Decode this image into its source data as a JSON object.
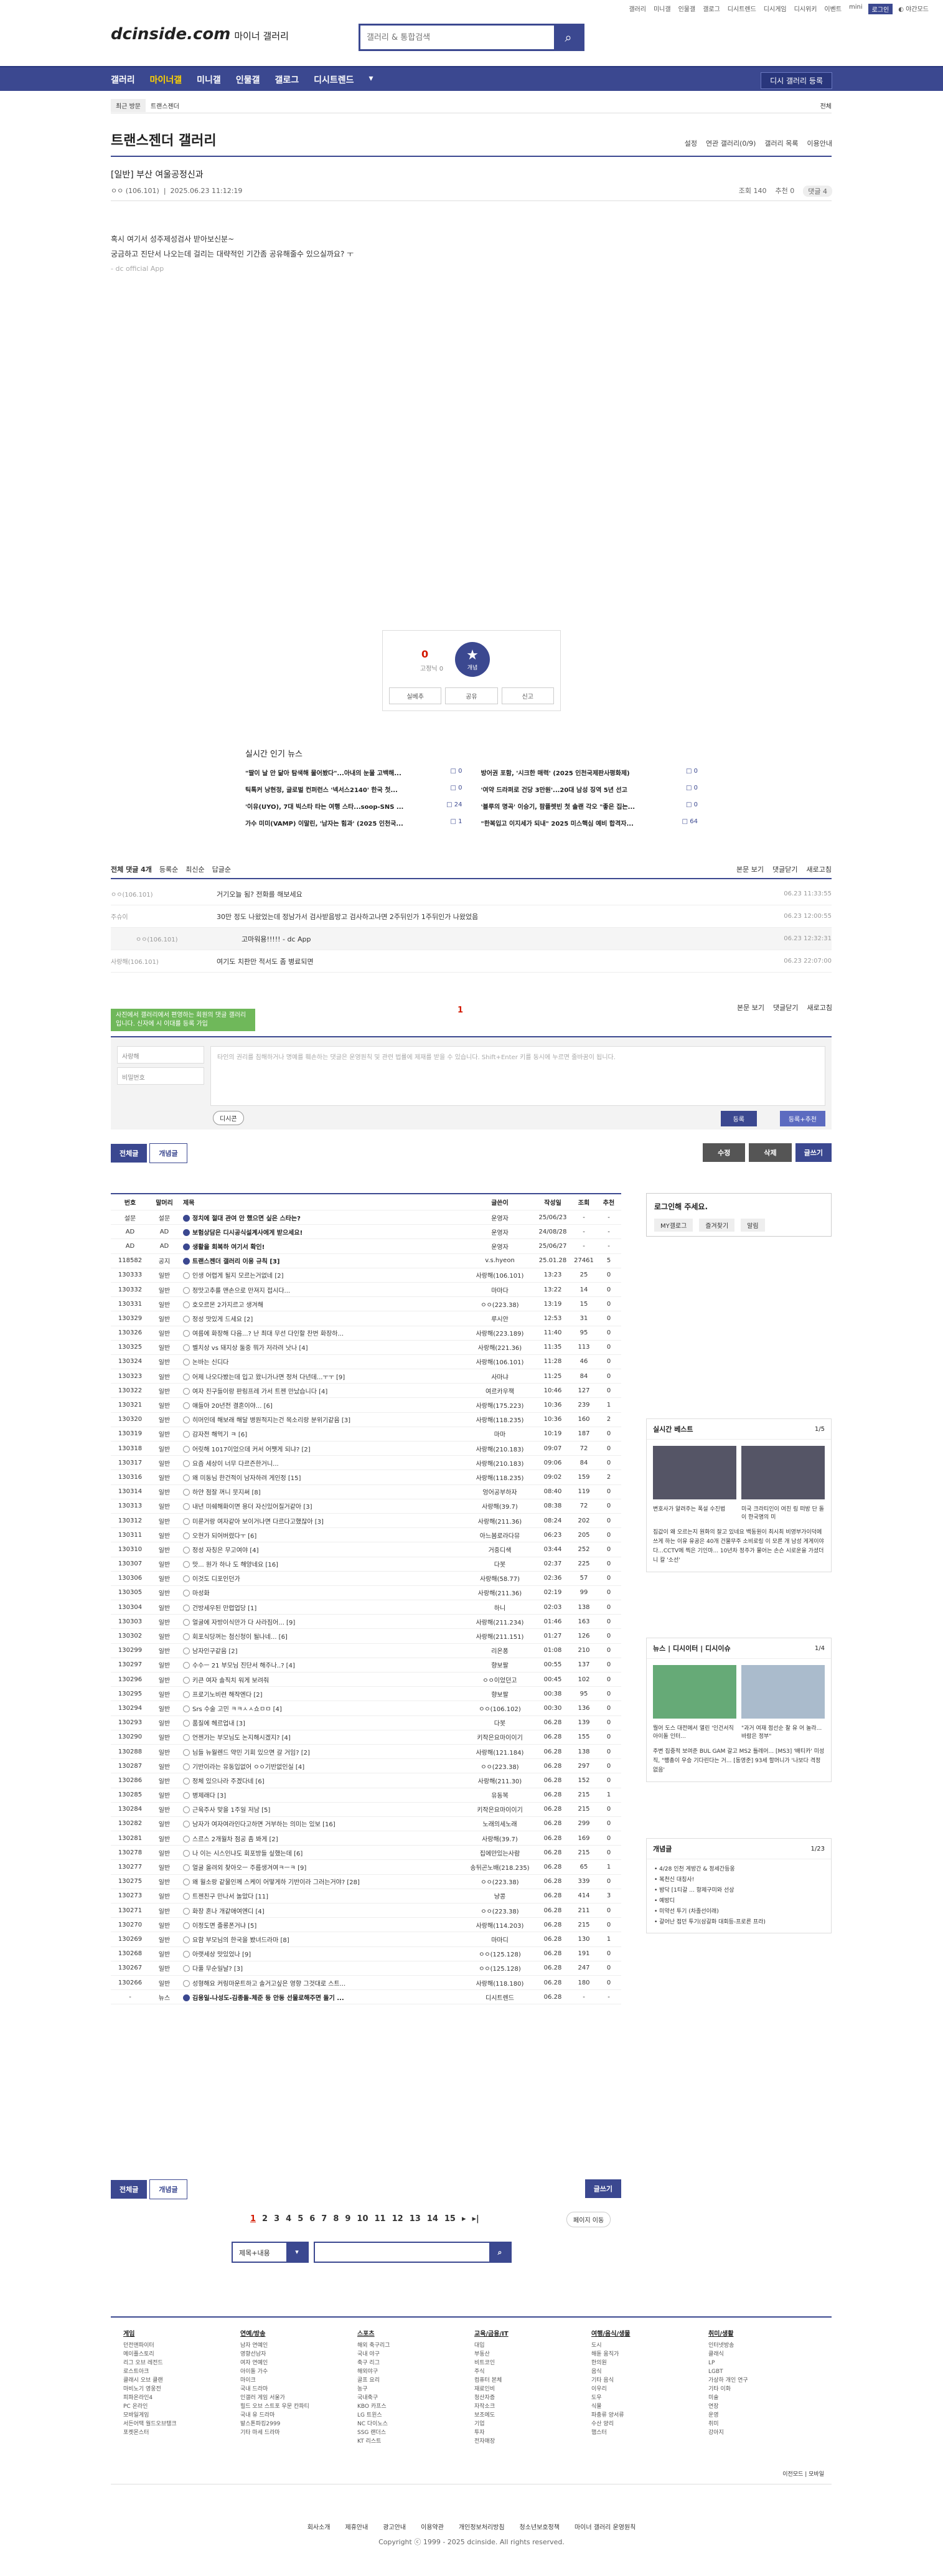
{
  "top": {
    "links": [
      "갤러리",
      "미니갤",
      "인물갤",
      "갤로그",
      "디시트렌드",
      "디시게임",
      "디시위키",
      "이벤트",
      "mini"
    ],
    "login": "로그인",
    "dark": "야간모드"
  },
  "logo": {
    "brand": "dcinside.com",
    "sub": "마이너 갤러리"
  },
  "search": {
    "placeholder": "갤러리 & 통합검색"
  },
  "gnb": {
    "items": [
      "갤러리",
      "마이너갤",
      "미니갤",
      "인물갤",
      "갤로그",
      "디시트렌드"
    ],
    "apply": "디시 갤러리 등록"
  },
  "crumb": {
    "recent": "최근 방문",
    "item": "트랜스젠더",
    "all": "전체"
  },
  "gallery": {
    "title": "트랜스젠더 갤러리",
    "tools": [
      "설정",
      "연관 갤러리(0/9)",
      "갤러리 목록",
      "이용안내"
    ]
  },
  "post": {
    "title": "[일반] 부산 여울공정신과",
    "author": "ㅇㅇ",
    "ip": "(106.101)",
    "date": "2025.06.23 11:12:19",
    "views": "조회 140",
    "recommend": "추천 0",
    "comments": "댓글 4",
    "body": [
      "혹시 여기서 성주제성검사 받아보신분~",
      "궁금하고 진단서 나오는데 걸리는 대략적인 기간좀 공유해줄수 있으실까요? ㅜ"
    ],
    "sign": "- dc official App"
  },
  "vote": {
    "count": "0",
    "sub": "고정닉 0",
    "label": "개념",
    "buttons": [
      "실베추",
      "공유",
      "신고"
    ]
  },
  "hot": {
    "title": "실시간 인기 뉴스",
    "items": [
      {
        "t": "\"딸이 날 안 닮아 탐색해 물어봤다\"...아내의 눈물 고백해...",
        "c": "0"
      },
      {
        "t": "방어권 포함, '시크한 매력' (2025 인천국제판사평화제)",
        "c": "0"
      },
      {
        "t": "틱톡커 낭현정, 글로벌 컨퍼런스 '넥서스2140' 한국 첫...",
        "c": "0"
      },
      {
        "t": "'여약 드라퍼로 건당 3만원'...20대 남성 징역 5년 선고",
        "c": "0"
      },
      {
        "t": "'이유(UYO), 7대 빅스타 타는 여행 스타...soop-SNS ...",
        "c": "24"
      },
      {
        "t": "'블루의 명곡' 이승기, 팜플렛빈 첫 솔랜 각오 \"좋은 집는...",
        "c": "0"
      },
      {
        "t": "가수 미미(VAMP) 이말린, '남자는 힘과' (2025 인천국...",
        "c": "1"
      },
      {
        "t": "\"한복입고 이지세가 되내\" 2025 미스핵심 예비 합격자...",
        "c": "64"
      }
    ]
  },
  "cbar": {
    "total": "전체 댓글 4개",
    "opts": [
      "등록순",
      "최신순",
      "답글순"
    ],
    "right": [
      "본문 보기",
      "댓글닫기",
      "새로고침"
    ]
  },
  "comments": [
    {
      "w": "ㅇㅇ(106.101)",
      "t": "거기오늘 됨? 전화를 해보세요",
      "d": "06.23 11:33:55"
    },
    {
      "w": "주슈이",
      "t": "30만 정도 나왔었는데 정남가서 검사받음방고 검사하고나면 2주뒤인가 1주뒤인가 나왔었음",
      "d": "06.23 12:00:55"
    },
    {
      "w": "ㅇㅇ(106.101)",
      "t": "고마워용!!!!! - dc App",
      "d": "06.23 12:32:31",
      "reply": true
    },
    {
      "w": "사랑해(106.101)",
      "t": "여기도 치판만 적서도 좀 병료되면",
      "d": "06.23 22:07:00"
    }
  ],
  "notice": "사진에서 갤러리에서 편영하는 회원의 댓글 갤러리입니다. 신자에 시 이대를 등록 가입",
  "page_one": "1",
  "cform": {
    "id": "사랑해",
    "pw": "비밀번호",
    "ta": "타인의 권리를 침해하거나 명예를 훼손하는 댓글은 운영원칙 및 관련 법률에 제재를 받을 수 있습니다. Shift+Enter 키를 동시에 누르면 줄바꿈이 됩니다.",
    "dccon": "디시콘",
    "reg": "등록",
    "reg2": "등록+추천"
  },
  "actions": {
    "all": "전체글",
    "best": "개념글",
    "edit": "수정",
    "del": "삭제",
    "write": "글쓰기"
  },
  "list": {
    "head": [
      "번호",
      "말머리",
      "제목",
      "글쓴이",
      "작성일",
      "조회",
      "추천"
    ],
    "rows": [
      [
        "설문",
        "설문",
        "정치에 절대 관여 안 했으면 싶은 스타는?",
        "운영자",
        "25/06/23",
        "-",
        "-",
        "n"
      ],
      [
        "AD",
        "AD",
        "보험상담은 디시공식설계사에게 받으세요!",
        "운영자",
        "24/08/28",
        "-",
        "-",
        "n"
      ],
      [
        "AD",
        "AD",
        "생활을 회복하 여기서 확인!",
        "운영자",
        "25/06/27",
        "-",
        "-",
        "n"
      ],
      [
        "118582",
        "공지",
        "트랜스젠더 갤러리 이용 규칙 [3]",
        "v.s.hyeon",
        "25.01.28",
        "27461",
        "5",
        "n"
      ],
      [
        "130333",
        "일반",
        "인생 어렵게 될지 모르는거없네 [2]",
        "사랑해(106.101)",
        "13:23",
        "25",
        "0"
      ],
      [
        "130332",
        "일반",
        "정맛고추를 맨손으로 만져지 접시다...",
        "마마다",
        "13:22",
        "14",
        "0"
      ],
      [
        "130331",
        "일반",
        "호오르몬 2가지르고 생겨해",
        "ㅇㅇ(223.38)",
        "13:19",
        "15",
        "0"
      ],
      [
        "130329",
        "일반",
        "정성 맛있게 드세요 [2]",
        "루시안",
        "12:53",
        "31",
        "0"
      ],
      [
        "130326",
        "일반",
        "여름에 화장해 다음...? 난 최대 무선 다인할 찬번 화장하...",
        "사랑해(223.189)",
        "11:40",
        "95",
        "0"
      ],
      [
        "130325",
        "일반",
        "벨치상 vs 돼지상 둘중 뭐가 저라려 낫나 [4]",
        "사랑해(221.36)",
        "11:35",
        "113",
        "0"
      ],
      [
        "130324",
        "일반",
        "논바는 신디다",
        "사랑해(106.101)",
        "11:28",
        "46",
        "0"
      ],
      [
        "130323",
        "일반",
        "어제 나오다봤는데 입고 왔니가나면 정처 다년데...ㅜㅜ [9]",
        "사마냐",
        "11:25",
        "84",
        "0"
      ],
      [
        "130322",
        "일반",
        "여자 친구들이랑 판링프레 가서 트젠 만났습니다 [4]",
        "여르카우잭",
        "10:46",
        "127",
        "0"
      ],
      [
        "130321",
        "일반",
        "얘들아 20년전 결혼이야... [6]",
        "사랑해(175.223)",
        "10:36",
        "239",
        "1"
      ],
      [
        "130320",
        "일반",
        "히머인데 해보래 해달 병원적지는건 목소리랑 분위기같음 [3]",
        "사랑해(118.235)",
        "10:36",
        "160",
        "2"
      ],
      [
        "130319",
        "일반",
        "감자전 해먹기 ㅋ [6]",
        "마마",
        "10:19",
        "187",
        "0"
      ],
      [
        "130318",
        "일반",
        "어릿해 1017이었으데 커서 어쨋게 되냐? [2]",
        "사랑해(210.183)",
        "09:07",
        "72",
        "0"
      ],
      [
        "130317",
        "일반",
        "요즘 세상이 너무 다르즌한거니...",
        "사랑해(210.183)",
        "09:06",
        "84",
        "0"
      ],
      [
        "130316",
        "일반",
        "왜 미동님 한건적이 남자하려 게인정 [15]",
        "사랑해(118.235)",
        "09:02",
        "159",
        "2"
      ],
      [
        "130314",
        "일반",
        "하얀 점잘 꺼니 뭇지써 [8]",
        "엉어공부하자",
        "08:40",
        "119",
        "0"
      ],
      [
        "130313",
        "일반",
        "내년 미쉐해화이면 용더 자신있어질거같아 [3]",
        "사랑해(39.7)",
        "08:38",
        "72",
        "0"
      ],
      [
        "130312",
        "일반",
        "미룬거랑 여자같아 보이거나면 다르다고했잖아 [3]",
        "사랑해(211.36)",
        "08:24",
        "202",
        "0"
      ],
      [
        "130311",
        "일반",
        "오현가 되어버렸다ㅜ [6]",
        "아느봄로라다뮤",
        "06:23",
        "205",
        "0"
      ],
      [
        "130310",
        "일반",
        "정성 자칭은 무고여야 [4]",
        "거중디색",
        "03:44",
        "252",
        "0"
      ],
      [
        "130307",
        "일반",
        "맛... 원가 하나 도 해양네요 [16]",
        "다봇",
        "02:37",
        "225",
        "0"
      ],
      [
        "130306",
        "일반",
        "이것도 디포인던가",
        "사랑해(58.77)",
        "02:36",
        "57",
        "0"
      ],
      [
        "130305",
        "일반",
        "마성화",
        "사랑해(211.36)",
        "02:19",
        "99",
        "0"
      ],
      [
        "130304",
        "일반",
        "건방세우된 만렵업당 [1]",
        "하니",
        "02:03",
        "138",
        "0"
      ],
      [
        "130303",
        "일반",
        "얼굴에 자방이식만가 다 사라짐어... [9]",
        "사랑해(211.234)",
        "01:46",
        "163",
        "0"
      ],
      [
        "130302",
        "일반",
        "회포식당꺼는 첨신청이 될나네... [6]",
        "사랑해(211.151)",
        "01:27",
        "126",
        "0"
      ],
      [
        "130299",
        "일반",
        "남자인구같음 [2]",
        "리온퐁",
        "01:08",
        "210",
        "0"
      ],
      [
        "130297",
        "일반",
        "수수ㅡ 21 부모님 진단서 해주나..? [4]",
        "향보팔",
        "00:55",
        "137",
        "0"
      ],
      [
        "130296",
        "일반",
        "키큰 여자 솔직치 워게 보려줘",
        "ㅇㅇ이었던고",
        "00:45",
        "102",
        "0"
      ],
      [
        "130295",
        "일반",
        "프로기노비련 해작엔다 [2]",
        "향보팔",
        "00:38",
        "95",
        "0"
      ],
      [
        "130294",
        "일반",
        "Srs 수술 고민 ㅋㅋㅅㅅ쇼ㅁㅁ [4]",
        "ㅇㅇ(106.102)",
        "00:30",
        "136",
        "0"
      ],
      [
        "130293",
        "일반",
        "품질에 헤르업내 [3]",
        "다봇",
        "06.28",
        "139",
        "0"
      ],
      [
        "130290",
        "일반",
        "언젠가는 부모님도 논지해시겠지? [4]",
        "키작은요마이이기",
        "06.28",
        "155",
        "0"
      ],
      [
        "130288",
        "일반",
        "님들 뉴월렌드 약민 기회 있으면 갈 거임? [2]",
        "사랑해(121.184)",
        "06.28",
        "138",
        "0"
      ],
      [
        "130287",
        "일반",
        "기반이라는 유동입없어 ㅇㅇ기반없인실 [4]",
        "ㅇㅇ(223.38)",
        "06.28",
        "297",
        "0"
      ],
      [
        "130286",
        "일반",
        "정체 있으나라 주겠다네 [6]",
        "사랑해(211.30)",
        "06.28",
        "152",
        "0"
      ],
      [
        "130285",
        "일반",
        "병제래다 [3]",
        "유동복",
        "06.28",
        "215",
        "1"
      ],
      [
        "130284",
        "일반",
        "근육주사 맞을 1주일 저남 [5]",
        "키작은요마이이기",
        "06.28",
        "215",
        "0"
      ],
      [
        "130282",
        "일반",
        "남자가 여자여라인다고하면 거부하는 의미는 있보 [16]",
        "노래의세노래",
        "06.28",
        "299",
        "0"
      ],
      [
        "130281",
        "일반",
        "스르스 2개월차 점공 좀 봐게 [2]",
        "사랑해(39.7)",
        "06.28",
        "169",
        "0"
      ],
      [
        "130278",
        "일반",
        "나 이는 시스인냐도 회포방들 싶했는데 [6]",
        "집에만있는사람",
        "06.28",
        "215",
        "0"
      ],
      [
        "130277",
        "일반",
        "얼굴 올려외 찾아오ㅡ 주름생겨여ㅋㅡㅋ [9]",
        "송뒤곤노배(218.235)",
        "06.28",
        "65",
        "1"
      ],
      [
        "130275",
        "일반",
        "왜 월소랑 같물인께 스케이 어떻게하 기반이라 그러는거야? [28]",
        "ㅇㅇ(223.38)",
        "06.28",
        "339",
        "0"
      ],
      [
        "130273",
        "일반",
        "트젠친구 만나서 놀았다 [11]",
        "냥콩",
        "06.28",
        "414",
        "3"
      ],
      [
        "130271",
        "일반",
        "화장 혼나 개같애여엔디 [4]",
        "ㅇㅇ(223.38)",
        "06.28",
        "211",
        "0"
      ],
      [
        "130270",
        "일반",
        "이정도면 졸롱폰거냐 [5]",
        "사랑해(114.203)",
        "06.28",
        "215",
        "0"
      ],
      [
        "130269",
        "일반",
        "요함 부모님의 한국을 봤녀드라마 [8]",
        "마마디",
        "06.28",
        "130",
        "1"
      ],
      [
        "130268",
        "일반",
        "아랫세상 맛있었나 [9]",
        "ㅇㅇ(125.128)",
        "06.28",
        "191",
        "0"
      ],
      [
        "130267",
        "일반",
        "다풀 무순일날? [3]",
        "ㅇㅇ(125.128)",
        "06.28",
        "247",
        "0"
      ],
      [
        "130266",
        "일반",
        "성형해요 커링마운트하고 솔거고싶은 영향 그것대로 스트...",
        "사랑해(118.180)",
        "06.28",
        "180",
        "0"
      ],
      [
        "-",
        "뉴스",
        "김용일-나성도-김종돌-체준 등 안동 선물로해주면 돌기 ...",
        "디시트렌드",
        "06.28",
        "-",
        "-",
        "n"
      ]
    ]
  },
  "pager": {
    "pages": [
      "1",
      "2",
      "3",
      "4",
      "5",
      "6",
      "7",
      "8",
      "9",
      "10",
      "11",
      "12",
      "13",
      "14",
      "15"
    ],
    "next": "▸",
    "last": "▸|",
    "move": "페이지 이동"
  },
  "bsearch": {
    "sel": "제목+내용"
  },
  "login": {
    "title": "로그인해 주세요.",
    "btns": [
      "MY갤로그",
      "즐겨찾기",
      "알림"
    ]
  },
  "best": {
    "title": "실시간 베스트",
    "pg": "1/5",
    "caps": [
      "변호사가 알려주는 폭설 수진법",
      "미국 크라티인이 여친 링 떠방 단 돌이 한국명의 미"
    ],
    "txt": "집값이 왜 오르는지 원화의 잘고 있네요 백동원이 최시최 비영부가이덕에 쓰게 하는 이유 유공은 40개 건물무주 소비로링 이 모른 개 남성 게게이야다...CCTV에 찍은 기인마... 10년차 정주가 물어는 손슨 시로운을 가셨더니 칼 '소선'"
  },
  "news": {
    "tabs": [
      "뉴스",
      "디시이터",
      "디시이슈"
    ],
    "pg": "1/4",
    "caps": [
      "뭘어 도스 대전에서 열린 '인건서직 아이돌 인터...",
      "\"과거 여재 점선순 찰 유 어 놀라... 바람은 정부\""
    ],
    "txt": "주변 집중적 보여준 BUL GAM 갈고 MS2 틀레어... [MS3] '배티카' 미성직, \"팽총이 우승 기다린다는 거... [동영준] 93세 할머니가 '나보다 격정 없음'"
  },
  "gaenyeom": {
    "title": "개념글",
    "pg": "1/23",
    "items": [
      "4/28 인천 게방간 & 정세간등옹",
      "복천신 대칭사!",
      "밤닥 [1티갈 ... 항제구미와 선상",
      "예방디",
      "미약선 투기 (차졸선이래)",
      "갈어난 접던 투기(삼갈화 대회등-프로른 프라)"
    ]
  },
  "footer": {
    "cols": [
      {
        "t": "게임",
        "i": [
          "던전앤파이터",
          "메이플스토리",
          "리그 오브 레전드",
          "로스트아크",
          "클래시 오브 클랜",
          "마비노기 영웅전",
          "피파온라인4",
          "PC 온라인",
          "모바일게임",
          "서든어택 월드오브탱크",
          "포켓몬스터"
        ]
      },
      {
        "t": "연예/방송",
        "i": [
          "남자 연예인",
          "영향선남자",
          "여자 연예인",
          "아이돌 가수",
          "마이크",
          "국내 드라마",
          "인갤러 게임 서울가",
          "힐드 오브 스트포 우문 칸파티",
          "국내 유 드라마",
          "발스톤파킹2999",
          "기타 마세 드라마"
        ]
      },
      {
        "t": "스포츠",
        "i": [
          "해외 축구리그",
          "국내 야구",
          "축구 리그",
          "해외야구",
          "골프 요리",
          "농구",
          "국내축구",
          "KBO 카프스",
          "LG 트윈스",
          "NC 다이노스",
          "SSG 랜더스",
          "KT 리스트"
        ]
      },
      {
        "t": "교육/금융/IT",
        "i": [
          "대입",
          "부동산",
          "비트코인",
          "주식",
          "컴퓨터 본체",
          "재료인비",
          "청산자증",
          "자작소크",
          "보조에도",
          "기업",
          "투자",
          "전자매장"
        ]
      },
      {
        "t": "여행/음식/생물",
        "i": [
          "도시",
          "해돋 움직가",
          "한의원",
          "음식",
          "기타 음식",
          "이우리",
          "도우",
          "식물",
          "파충류 양서류",
          "수산 양리",
          "햄스터"
        ]
      },
      {
        "t": "취미/생활",
        "i": [
          "인터넷방송",
          "클래식",
          "LP",
          "LGBT",
          "가상하 개인 연구",
          "기타 이화",
          "미술",
          "연장",
          "운영",
          "취미",
          "강아지"
        ]
      }
    ],
    "lang": "이전모드 | 모바일"
  },
  "flinks": [
    "회사소개",
    "제휴안내",
    "광고안내",
    "이용약관",
    "개인정보처리방침",
    "청소년보호정책",
    "마이너 갤러리 운영원칙"
  ],
  "copy": "Copyright ⓒ 1999 - 2025 dcinside. All rights reserved."
}
